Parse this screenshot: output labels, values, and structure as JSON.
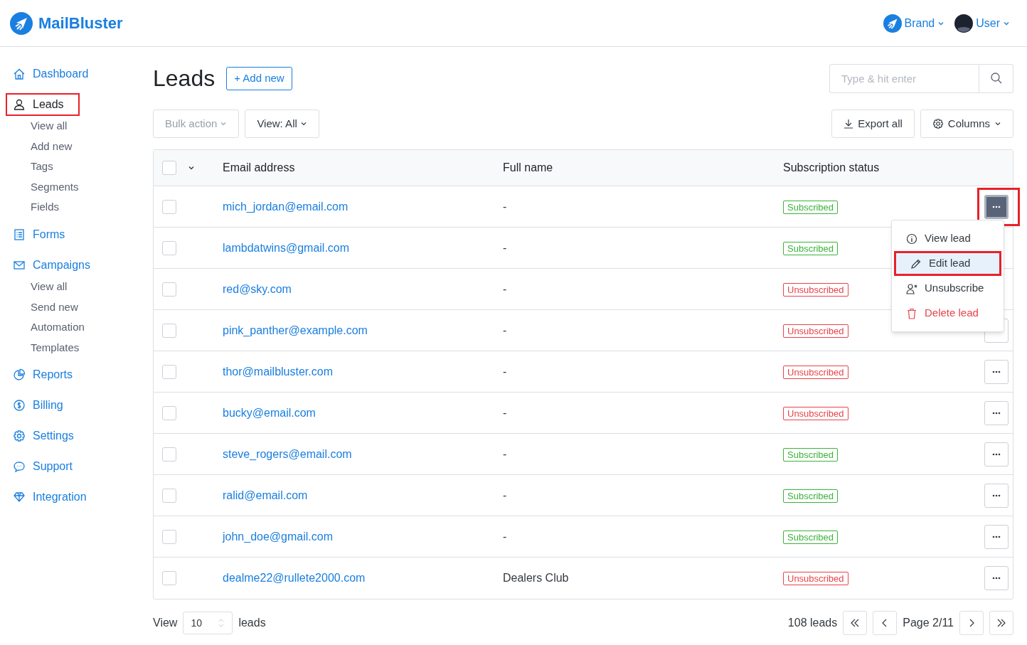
{
  "header": {
    "logo": "MailBluster",
    "brand": "Brand",
    "user": "User"
  },
  "sidebar": {
    "items": [
      {
        "label": "Dashboard",
        "selected": false,
        "highlighted": false
      },
      {
        "label": "Leads",
        "selected": true,
        "highlighted": true,
        "children": [
          {
            "label": "View all"
          },
          {
            "label": "Add new"
          },
          {
            "label": "Tags"
          },
          {
            "label": "Segments"
          },
          {
            "label": "Fields"
          }
        ]
      },
      {
        "label": "Forms",
        "selected": false,
        "highlighted": false
      },
      {
        "label": "Campaigns",
        "selected": false,
        "highlighted": false,
        "children": [
          {
            "label": "View all"
          },
          {
            "label": "Send new"
          },
          {
            "label": "Automation"
          },
          {
            "label": "Templates"
          }
        ]
      },
      {
        "label": "Reports",
        "selected": false,
        "highlighted": false
      },
      {
        "label": "Billing",
        "selected": false,
        "highlighted": false
      },
      {
        "label": "Settings",
        "selected": false,
        "highlighted": false
      },
      {
        "label": "Support",
        "selected": false,
        "highlighted": false
      },
      {
        "label": "Integration",
        "selected": false,
        "highlighted": false
      }
    ]
  },
  "page": {
    "title": "Leads",
    "add_button": "+ Add new",
    "search": {
      "placeholder": "Type & hit enter"
    }
  },
  "toolbar": {
    "bulk_action": {
      "label": "Bulk action",
      "disabled": true
    },
    "view_filter": "View: All",
    "export": "Export all",
    "columns": "Columns"
  },
  "table": {
    "select_all_checked": false,
    "columns": [
      "Email address",
      "Full name",
      "Subscription status"
    ],
    "rows": [
      {
        "email": "mich_jordan@email.com",
        "full_name": "-",
        "status": {
          "label": "Subscribed",
          "kind": "subscribed"
        },
        "checked": false,
        "menu_open": true,
        "highlighted": true
      },
      {
        "email": "lambdatwins@gmail.com",
        "full_name": "-",
        "status": {
          "label": "Subscribed",
          "kind": "subscribed"
        },
        "checked": false,
        "actions_covered": true
      },
      {
        "email": "red@sky.com",
        "full_name": "-",
        "status": {
          "label": "Unsubscribed",
          "kind": "unsubscribed"
        },
        "checked": false,
        "actions_covered": true
      },
      {
        "email": "pink_panther@example.com",
        "full_name": "-",
        "status": {
          "label": "Unsubscribed",
          "kind": "unsubscribed"
        },
        "checked": false,
        "menu_open": false,
        "highlighted": false
      },
      {
        "email": "thor@mailbluster.com",
        "full_name": "-",
        "status": {
          "label": "Unsubscribed",
          "kind": "unsubscribed"
        },
        "checked": false,
        "menu_open": false,
        "highlighted": false
      },
      {
        "email": "bucky@email.com",
        "full_name": "-",
        "status": {
          "label": "Unsubscribed",
          "kind": "unsubscribed"
        },
        "checked": false,
        "menu_open": false,
        "highlighted": false
      },
      {
        "email": "steve_rogers@email.com",
        "full_name": "-",
        "status": {
          "label": "Subscribed",
          "kind": "subscribed"
        },
        "checked": false,
        "menu_open": false,
        "highlighted": false
      },
      {
        "email": "ralid@email.com",
        "full_name": "-",
        "status": {
          "label": "Subscribed",
          "kind": "subscribed"
        },
        "checked": false,
        "menu_open": false,
        "highlighted": false
      },
      {
        "email": "john_doe@gmail.com",
        "full_name": "-",
        "status": {
          "label": "Subscribed",
          "kind": "subscribed"
        },
        "checked": false,
        "menu_open": false,
        "highlighted": false
      },
      {
        "email": "dealme22@rullete2000.com",
        "full_name": "Dealers Club",
        "status": {
          "label": "Unsubscribed",
          "kind": "unsubscribed"
        },
        "checked": false,
        "menu_open": false,
        "highlighted": false
      }
    ]
  },
  "row_menu": {
    "items": [
      {
        "label": "View lead",
        "kind": "info",
        "selected": false,
        "highlighted": false
      },
      {
        "label": "Edit lead",
        "kind": "edit",
        "selected": true,
        "highlighted": true
      },
      {
        "label": "Unsubscribe",
        "kind": "unsubscribe",
        "selected": false,
        "highlighted": false
      },
      {
        "label": "Delete lead",
        "kind": "delete",
        "selected": false,
        "highlighted": false
      }
    ]
  },
  "footer": {
    "view_label": "View",
    "per_page": "10",
    "leads_label": "leads",
    "total": "108 leads",
    "page": "Page 2/11"
  }
}
